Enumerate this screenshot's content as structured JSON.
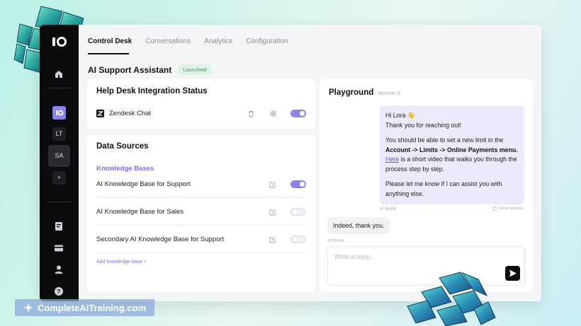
{
  "tabs": [
    {
      "label": "Control Desk",
      "active": true
    },
    {
      "label": "Conversations",
      "active": false
    },
    {
      "label": "Analytics",
      "active": false
    },
    {
      "label": "Configuration",
      "active": false
    }
  ],
  "page": {
    "title": "AI Support Assistant",
    "status_badge": "Launched"
  },
  "sidebar": {
    "tiles": [
      "LT",
      "SA",
      "+"
    ],
    "icons": [
      "home-icon",
      "document-icon",
      "card-icon",
      "user-icon",
      "help-icon"
    ]
  },
  "integration": {
    "title": "Help Desk Integration Status",
    "item": {
      "name": "Zendesk Chat",
      "enabled": true
    }
  },
  "sources": {
    "title": "Data Sources",
    "section": "Knowledge Bases",
    "items": [
      {
        "name": "AI Knowledge Base for Support",
        "enabled": true
      },
      {
        "name": "AI Knowledge Base for Sales",
        "enabled": false
      },
      {
        "name": "Secondary AI Knowledge Base for Support",
        "enabled": false
      }
    ],
    "add_label": "Add knowledge base  +"
  },
  "playground": {
    "title": "Playground",
    "version": "Version 3",
    "bot_message": {
      "greeting": "Hi Lora 👋",
      "line2": "Thank you for reaching out!",
      "p2_a": "You should be able to set a new limit in the ",
      "p2_bold": "Account -> Limits -> Online Payments menu.",
      "p2_link": "Here",
      "p2_b": " is a short video that walks you through the process step by step.",
      "p3": "Please let me know if I can assist you with anything else.",
      "time": "07:09 AM",
      "show_sources": "Show sources"
    },
    "user_message": {
      "text": "Indeed, thank you.",
      "time": "07:09 AM"
    },
    "reply_placeholder": "Write a reply..."
  },
  "watermark": "CompleteAiTraining.com",
  "colors": {
    "accent": "#8b83ec",
    "sidebar": "#0b0b0d",
    "badge_text": "#3c9a58"
  }
}
